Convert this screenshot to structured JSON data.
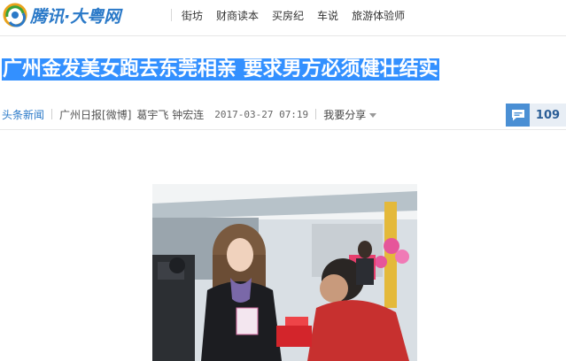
{
  "site": {
    "logo_text": "腾讯·大粤网",
    "logo_icon": "tencent-logo-icon"
  },
  "nav": {
    "items": [
      {
        "label": "街坊"
      },
      {
        "label": "财商读本"
      },
      {
        "label": "买房纪"
      },
      {
        "label": "车说"
      },
      {
        "label": "旅游体验师"
      }
    ]
  },
  "article": {
    "title": "广州金发美女跑去东莞相亲 要求男方必须健壮结实",
    "channel": "头条新闻",
    "source": "广州日报[微博]",
    "authors": "葛宇飞 钟宏连",
    "datetime": "2017-03-27 07:19",
    "share_label": "我要分享",
    "comment_count": "109"
  },
  "colors": {
    "brand_blue": "#2a79c8",
    "title_highlight": "#3390ff",
    "comment_icon_bg": "#4a8fd4"
  }
}
